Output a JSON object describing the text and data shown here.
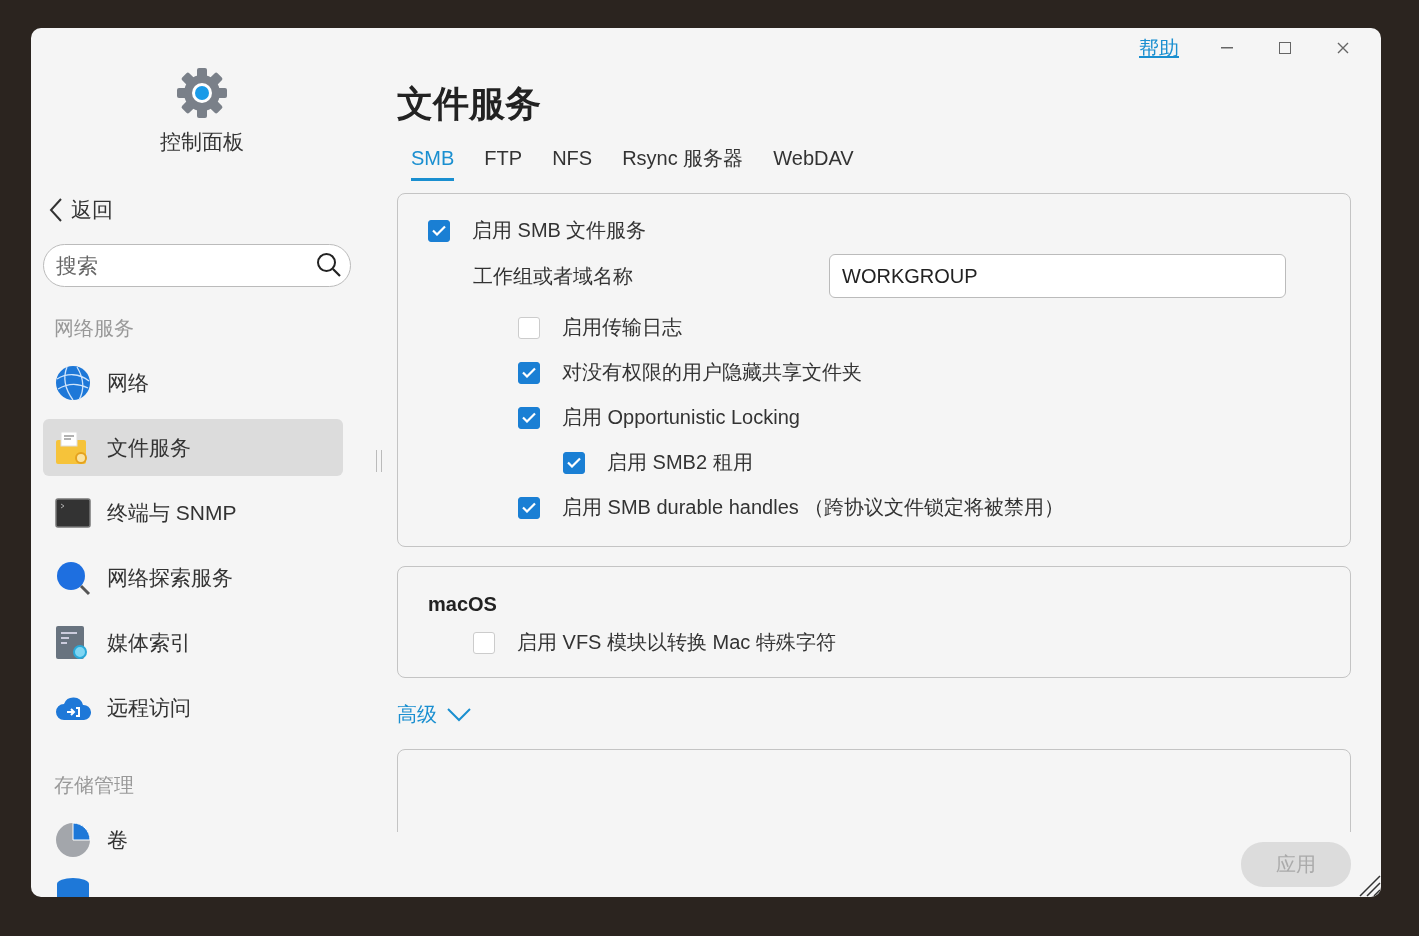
{
  "window": {
    "help_link": "帮助"
  },
  "sidebar": {
    "app_title": "控制面板",
    "back": "返回",
    "search": {
      "placeholder": "搜索"
    },
    "sections": [
      {
        "title": "网络服务",
        "items": [
          {
            "label": "网络",
            "selected": false
          },
          {
            "label": "文件服务",
            "selected": true
          },
          {
            "label": "终端与 SNMP",
            "selected": false
          },
          {
            "label": "网络探索服务",
            "selected": false
          },
          {
            "label": "媒体索引",
            "selected": false
          },
          {
            "label": "远程访问",
            "selected": false
          }
        ]
      },
      {
        "title": "存储管理",
        "items": [
          {
            "label": "卷",
            "selected": false
          }
        ]
      }
    ]
  },
  "main": {
    "title": "文件服务",
    "tabs": [
      {
        "label": "SMB",
        "selected": true
      },
      {
        "label": "FTP",
        "selected": false
      },
      {
        "label": "NFS",
        "selected": false
      },
      {
        "label": "Rsync 服务器",
        "selected": false
      },
      {
        "label": "WebDAV",
        "selected": false
      }
    ],
    "smb_card": {
      "enable": {
        "label": "启用 SMB 文件服务",
        "checked": true
      },
      "workgroup": {
        "label": "工作组或者域名称",
        "value": "WORKGROUP"
      },
      "options": [
        {
          "label": "启用传输日志",
          "checked": false
        },
        {
          "label": "对没有权限的用户隐藏共享文件夹",
          "checked": true
        },
        {
          "label": "启用 Opportunistic Locking",
          "checked": true,
          "children": [
            {
              "label": "启用 SMB2 租用",
              "checked": true
            }
          ]
        },
        {
          "label": "启用 SMB durable handles （跨协议文件锁定将被禁用）",
          "checked": true
        }
      ]
    },
    "macos_card": {
      "heading": "macOS",
      "options": [
        {
          "label": "启用 VFS 模块以转换 Mac 特殊字符",
          "checked": false
        }
      ]
    },
    "advanced": {
      "label": "高级",
      "expanded": false
    },
    "footer": {
      "apply": {
        "label": "应用",
        "disabled": true
      }
    }
  }
}
